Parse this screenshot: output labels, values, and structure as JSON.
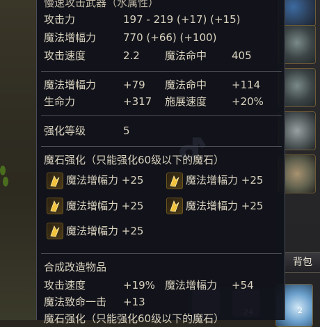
{
  "item": {
    "title": "慢速攻击武器（水属性）",
    "base_stats": [
      {
        "label": "攻击力",
        "value": "197 - 219 (+17) (+15)"
      },
      {
        "label": "魔法增幅力",
        "value": "770 (+66) (+100)"
      }
    ],
    "speed_row": {
      "label": "攻击速度",
      "value": "2.2",
      "label2": "魔法命中",
      "value2": "405"
    },
    "bonus_rows": [
      {
        "label": "魔法增幅力",
        "value": "+79",
        "label2": "魔法命中",
        "value2": "+114"
      },
      {
        "label": "生命力",
        "value": "+317",
        "label2": "施展速度",
        "value2": "+20%"
      }
    ],
    "enchant": {
      "label": "强化等级",
      "value": "5"
    },
    "manastone": {
      "header": "魔石强化（只能强化60级以下的魔石）",
      "stones": [
        {
          "text": "魔法增幅力 +25"
        },
        {
          "text": "魔法增幅力 +25"
        },
        {
          "text": "魔法增幅力 +25"
        },
        {
          "text": "魔法增幅力 +25"
        },
        {
          "text": "魔法增幅力 +25"
        }
      ]
    },
    "fusion": {
      "header": "合成改造物品",
      "rows": [
        {
          "label": "攻击速度",
          "value": "+19%",
          "label2": "魔法增幅力",
          "value2": "+54"
        },
        {
          "label": "魔法致命一击",
          "value": "+13"
        }
      ],
      "manastone_header_partial": "魔石强化（只能强化60级以下的魔石）"
    }
  },
  "inventory": {
    "bag_label": "背包",
    "bag_item_count": "2",
    "bottom_slot_count": "24"
  },
  "colors": {
    "panel_bg": "#10121a",
    "text": "#d9d2bf",
    "separator": "#4c4e5a",
    "gem_gold": "#f2c23a"
  },
  "icons": {
    "manastone": "gold-manastone-icon",
    "equipment_slots": [
      "blue-armor-icon",
      "shoulder-armor-icon",
      "chest-armor-icon",
      "ring-icon",
      "pants-armor-icon",
      "crystal-orb-icon"
    ]
  }
}
